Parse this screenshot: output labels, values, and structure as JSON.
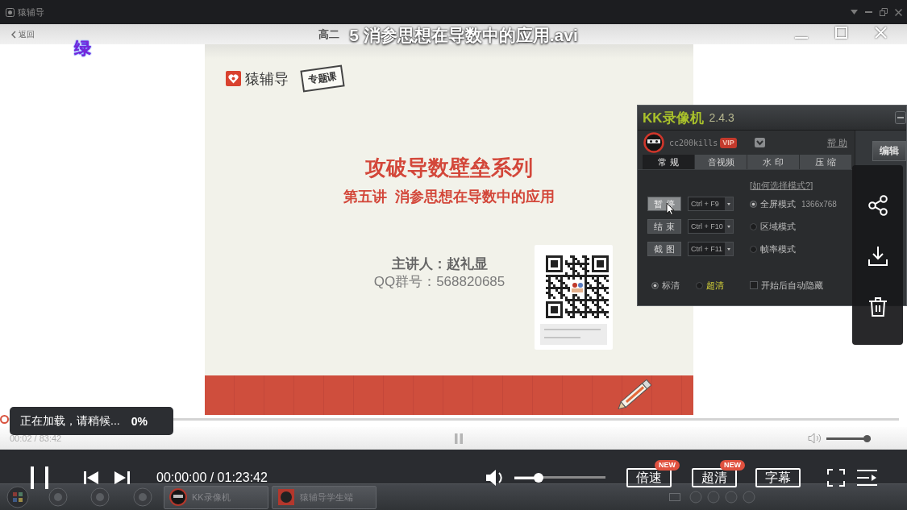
{
  "window": {
    "title": "猿辅导"
  },
  "video": {
    "title": "5 消参思想在导数中的应用.avi",
    "overlay_mark": "绿"
  },
  "recording": {
    "header": {
      "back": "返回",
      "title": "高二"
    },
    "slide": {
      "brand": "猿辅导",
      "tag": "专题课",
      "title": "攻破导数壁垒系列",
      "subtitle": "第五讲  消参思想在导数中的应用",
      "lecturer": "主讲人：赵礼显",
      "group": "QQ群号：568820685"
    },
    "recorder": {
      "name": "KK录像机",
      "version": "2.4.3",
      "user": "cc200kills",
      "badge": "VIP",
      "help": "帮 助",
      "tabs": [
        {
          "label": "常 规",
          "selected": true
        },
        {
          "label": "音视频",
          "selected": false
        },
        {
          "label": "水 印",
          "selected": false
        },
        {
          "label": "压 缩",
          "selected": false
        }
      ],
      "mode_help": "[如何选择模式?]",
      "actions": [
        {
          "label": "暂 停",
          "hotkey": "Ctrl + F9",
          "hover": true
        },
        {
          "label": "结 束",
          "hotkey": "Ctrl + F10",
          "hover": false
        },
        {
          "label": "截 图",
          "hotkey": "Ctrl + F11",
          "hover": false
        }
      ],
      "modes": [
        {
          "label": "全屏模式",
          "detail": "1366x768",
          "selected": true
        },
        {
          "label": "区域模式",
          "selected": false
        },
        {
          "label": "帧率模式",
          "selected": false
        }
      ],
      "quality": [
        {
          "label": "标清",
          "selected": true,
          "premium": false
        },
        {
          "label": "超清",
          "selected": false,
          "premium": true
        }
      ],
      "auto_hide": {
        "label": "开始后自动隐藏",
        "checked": false
      },
      "edit_button": "编辑"
    },
    "side_actions": [
      {
        "kind": "share"
      },
      {
        "kind": "download"
      },
      {
        "kind": "delete"
      }
    ],
    "loading_toast": {
      "message": "正在加载，请稍候...",
      "percent": "0%"
    },
    "player": {
      "time": "00:02 / 83:42",
      "playing": true,
      "progress": {
        "level": 0
      },
      "volume": {
        "level": 1
      }
    },
    "taskbar": {
      "items": [
        {
          "kind": "recorder",
          "label": "KK录像机"
        },
        {
          "kind": "tutor",
          "label": "猿辅导学生端"
        }
      ]
    }
  },
  "controls": {
    "playing": true,
    "time": "00:00:00 / 01:23:42",
    "volume": {
      "level": 0.24
    },
    "buttons": [
      {
        "label": "倍速",
        "badge": "NEW"
      },
      {
        "label": "超清",
        "badge": "NEW"
      },
      {
        "label": "字幕"
      }
    ]
  }
}
